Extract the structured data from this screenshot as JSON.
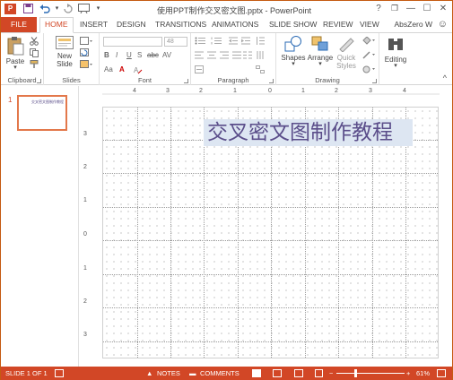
{
  "window": {
    "title": "使用PPT制作交叉密文图.pptx - PowerPoint",
    "app_logo": "P",
    "controls": [
      "?",
      "❐",
      "—",
      "☐",
      "✕"
    ]
  },
  "qat": {
    "save_icon": "save-icon",
    "undo_icon": "undo-icon",
    "redo_icon": "redo-icon",
    "customize_icon": "customize-icon"
  },
  "tabs": {
    "file": "FILE",
    "items": [
      "HOME",
      "INSERT",
      "DESIGN",
      "TRANSITIONS",
      "ANIMATIONS",
      "SLIDE SHOW",
      "REVIEW",
      "VIEW"
    ],
    "active": "HOME",
    "account": "AbsZero W",
    "smiley": "☺"
  },
  "ribbon": {
    "clipboard": {
      "label": "Clipboard",
      "paste": "Paste"
    },
    "slides": {
      "label": "Slides",
      "new_slide_line1": "New",
      "new_slide_line2": "Slide"
    },
    "font": {
      "label": "Font",
      "size": "48",
      "buttons": [
        "B",
        "I",
        "U",
        "S",
        "abc",
        "AV",
        "Aa",
        "A"
      ]
    },
    "paragraph": {
      "label": "Paragraph"
    },
    "drawing": {
      "label": "Drawing",
      "shapes": "Shapes",
      "arrange": "Arrange",
      "quick_line1": "Quick",
      "quick_line2": "Styles"
    },
    "editing": {
      "label": "Editing",
      "editing": "Editing"
    },
    "collapse": "^"
  },
  "ruler": {
    "h": [
      "4",
      "3",
      "2",
      "1",
      "0",
      "1",
      "2",
      "3",
      "4"
    ],
    "v": [
      "3",
      "2",
      "1",
      "0",
      "1",
      "2",
      "3"
    ]
  },
  "thumbnails": [
    {
      "number": "1",
      "text": "交叉密文图制作教程"
    }
  ],
  "slide": {
    "text": "交叉密文图制作教程"
  },
  "status": {
    "slide_info": "SLIDE 1 OF 1",
    "notes": "NOTES",
    "comments": "COMMENTS",
    "zoom_minus": "−",
    "zoom_plus": "+",
    "zoom_level": "61%",
    "zoom_fraction": 0.61
  },
  "colors": {
    "accent": "#d24726",
    "slide_text": "#5b4e8a",
    "text_highlight": "#dde6f2"
  }
}
